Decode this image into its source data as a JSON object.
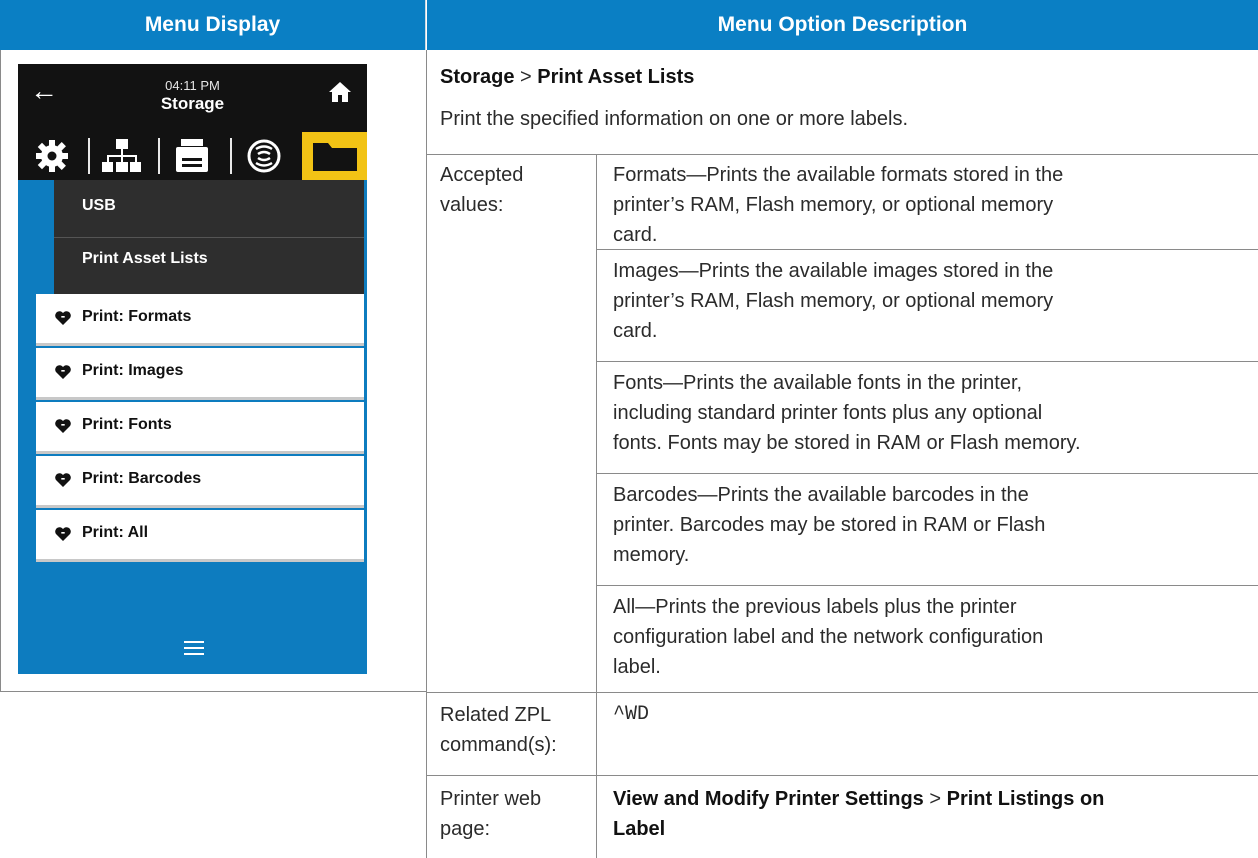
{
  "header": {
    "left": "Menu Display",
    "right": "Menu Option Description"
  },
  "device": {
    "time": "04:11 PM",
    "title": "Storage",
    "panel_items": [
      "USB",
      "Print Asset Lists"
    ],
    "list_items": [
      "Print: Formats",
      "Print: Images",
      "Print: Fonts",
      "Print: Barcodes",
      "Print: All"
    ],
    "colors": {
      "screen": "#0d7cbf",
      "topbar": "#121212",
      "selected_tab": "#f2c315"
    },
    "icons": [
      "back-arrow-icon",
      "home-icon",
      "gear-icon",
      "network-icon",
      "printer-icon",
      "wireless-icon",
      "folder-icon",
      "heart-icon",
      "hamburger-menu-icon"
    ]
  },
  "description": {
    "path_parent": "Storage",
    "path_sep": ">",
    "path_child": "Print Asset Lists",
    "summary": "Print the specified information on one or more labels.",
    "accepted_label": [
      "Accepted",
      "values:"
    ],
    "values": [
      [
        "Formats—Prints the available formats stored in the",
        "printer’s RAM, Flash memory, or optional memory",
        "card."
      ],
      [
        "Images—Prints the available images stored in the",
        "printer’s RAM, Flash memory, or optional memory",
        "card."
      ],
      [
        "Fonts—Prints the available fonts in the printer,",
        "including standard printer fonts plus any optional",
        "fonts. Fonts may be stored in RAM or Flash memory."
      ],
      [
        "Barcodes—Prints the available barcodes in the",
        "printer. Barcodes may be stored in RAM or Flash",
        "memory."
      ],
      [
        "All—Prints the previous labels plus the printer",
        "configuration label and the network configuration",
        "label."
      ]
    ],
    "zpl_label": [
      "Related ZPL",
      "command(s):"
    ],
    "zpl_value": "^WD",
    "web_label": [
      "Printer web",
      "page:"
    ],
    "web_part1": "View and Modify Printer Settings",
    "web_sep": ">",
    "web_part2a": "Print Listings on",
    "web_part2b": "Label"
  }
}
